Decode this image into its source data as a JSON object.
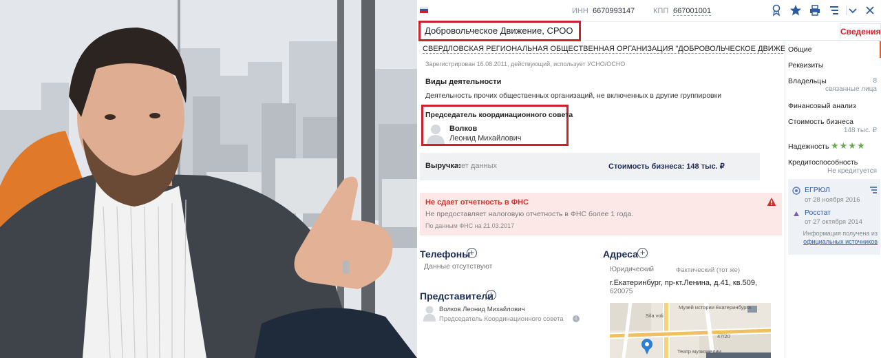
{
  "toolbar": {
    "inn_label": "ИНН",
    "inn_value": "6670993147",
    "kpp_label": "КПП",
    "kpp_value": "667001001",
    "icons": [
      "rating-icon",
      "star-icon",
      "print-icon",
      "list-icon",
      "dropdown-icon",
      "close-icon"
    ]
  },
  "company": {
    "short_name": "Добровольческое Движение, СРОО",
    "full_name": "СВЕРДЛОВСКАЯ РЕГИОНАЛЬНАЯ ОБЩЕСТВЕННАЯ ОРГАНИЗАЦИЯ \"ДОБРОВОЛЬЧЕСКОЕ ДВИЖЕНИЕ\"",
    "registration": "Зарегистрирован 16.08.2011, действующий, использует УСНО/ОСНО"
  },
  "tabs": {
    "active": "Сведения"
  },
  "activities": {
    "title": "Виды деятельности",
    "text": "Деятельность прочих общественных организаций, не включенных в другие группировки"
  },
  "leader": {
    "role": "Председатель координационного совета",
    "last_name": "Волков",
    "first_names": "Леонид Михайлович"
  },
  "finance": {
    "revenue_label": "Выручка:",
    "revenue_value": "нет данных",
    "business_value": "Стоимость бизнеса: 148 тыс. ₽"
  },
  "warning": {
    "title": "Не сдает отчетность в ФНС",
    "text": "Не предоставляет налоговую отчетность в ФНС более 1 года.",
    "source": "По данным ФНС на 21.03.2017",
    "color": "#d0312b"
  },
  "phones": {
    "title": "Телефоны",
    "empty": "Данные отсутствуют"
  },
  "addresses": {
    "title": "Адреса",
    "legal_label": "Юридический",
    "actual_label": "Фактический (тот же)",
    "address": "г.Екатеринбург, пр-кт.Ленина, д.41, кв.509,",
    "zip": "620075",
    "map_labels": [
      "Музей истории Екатеринбурга",
      "Театр музкомедии",
      "Sila voli",
      "47/20"
    ]
  },
  "representatives": {
    "title": "Представители",
    "name": "Волков Леонид Михайлович",
    "role": "Председатель Координационного совета"
  },
  "sidebar": {
    "items": [
      {
        "label": "Общие"
      },
      {
        "label": "Реквизиты"
      },
      {
        "label": "Владельцы",
        "count": "8",
        "sub": "связанные лица"
      },
      {
        "label": "Финансовый анализ"
      },
      {
        "label": "Стоимость бизнеса",
        "sub": "148 тыс. ₽"
      },
      {
        "label": "Надежность",
        "stars": "★★★★"
      },
      {
        "label": "Кредитоспособность",
        "sub": "Не кредитуется"
      }
    ],
    "sources": [
      {
        "title": "ЕГРЮЛ",
        "date": "от 28 ноября 2016"
      },
      {
        "title": "Росстат",
        "date": "от 27 октября 2014"
      }
    ],
    "sources_note": "Информация получена из",
    "sources_link": "официальных источников"
  },
  "colors": {
    "accent": "#d0212b",
    "link": "#2c5aa0",
    "nav_accent": "#e25b28",
    "stars": "#6aa84f"
  }
}
